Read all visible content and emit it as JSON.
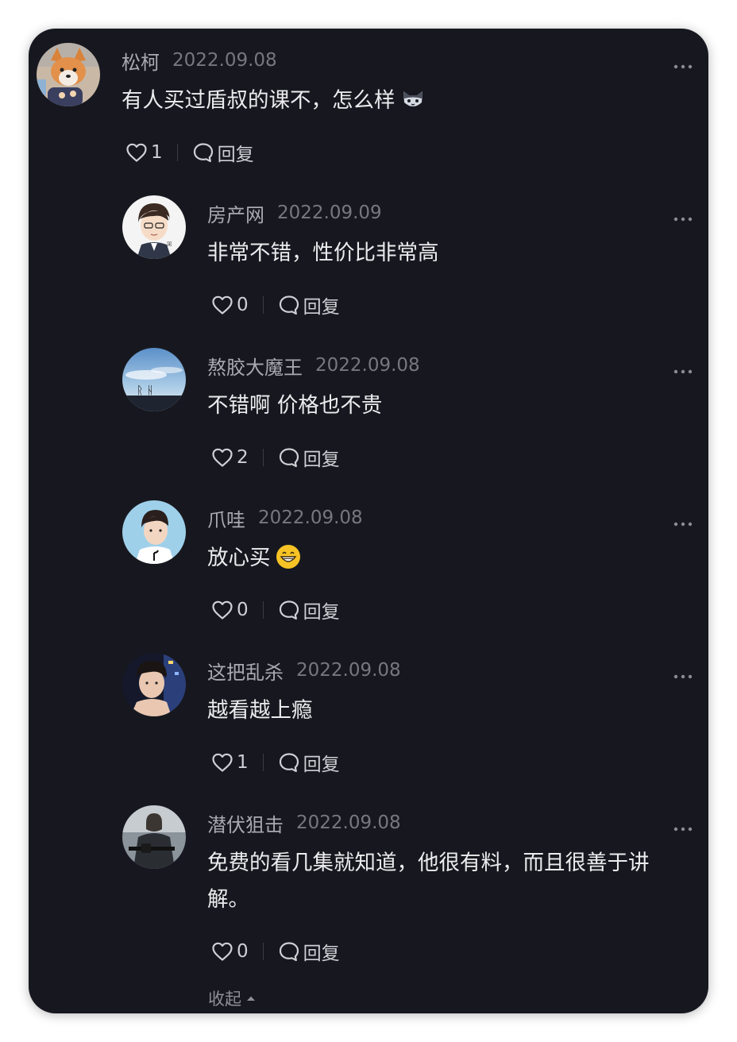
{
  "main_comment": {
    "author": "松柯",
    "date": "2022.09.08",
    "text": "有人买过盾叔的课不，怎么样",
    "emoji": "cat-face",
    "likes": "1",
    "reply_label": "回复"
  },
  "replies": [
    {
      "author": "房产网",
      "date": "2022.09.09",
      "text": "非常不错，性价比非常高",
      "likes": "0",
      "reply_label": "回复"
    },
    {
      "author": "熬胶大魔王",
      "date": "2022.09.08",
      "text": "不错啊 价格也不贵",
      "likes": "2",
      "reply_label": "回复"
    },
    {
      "author": "爪哇",
      "date": "2022.09.08",
      "text": "放心买",
      "emoji": "grinning-face",
      "likes": "0",
      "reply_label": "回复"
    },
    {
      "author": "这把乱杀",
      "date": "2022.09.08",
      "text": "越看越上瘾",
      "likes": "1",
      "reply_label": "回复"
    },
    {
      "author": "潜伏狙击",
      "date": "2022.09.08",
      "text": "免费的看几集就知道，他很有料，而且很善于讲解。",
      "likes": "0",
      "reply_label": "回复"
    }
  ],
  "collapse_label": "收起",
  "colors": {
    "card_bg": "#17181f",
    "name": "#a9aab1",
    "date": "#76777f",
    "text": "#ececef",
    "action": "#cfd0d5"
  },
  "icons": [
    "heart-outline-icon",
    "comment-bubble-icon",
    "more-dots-icon",
    "caret-up-icon"
  ]
}
